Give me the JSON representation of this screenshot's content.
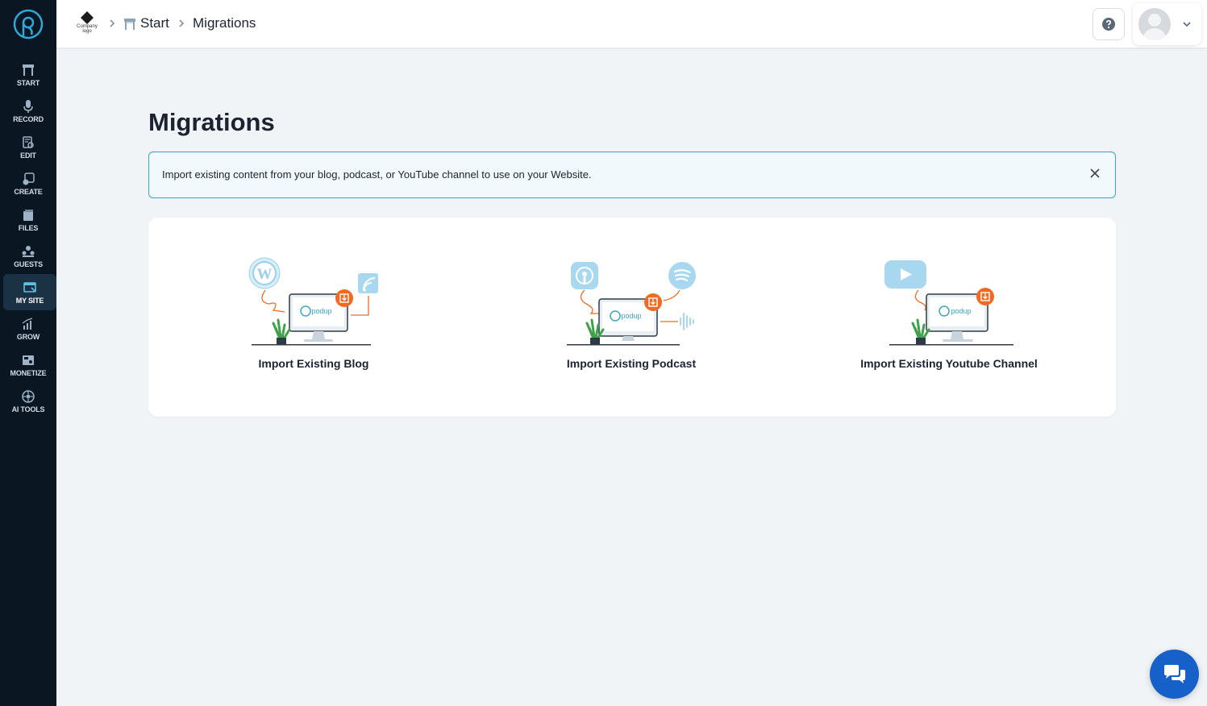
{
  "sidebar": {
    "items": [
      {
        "label": "START",
        "icon": "start-icon"
      },
      {
        "label": "RECORD",
        "icon": "microphone-icon"
      },
      {
        "label": "EDIT",
        "icon": "edit-icon"
      },
      {
        "label": "CREATE",
        "icon": "create-icon"
      },
      {
        "label": "FILES",
        "icon": "files-icon"
      },
      {
        "label": "GUESTS",
        "icon": "guests-icon"
      },
      {
        "label": "MY SITE",
        "icon": "my-site-icon",
        "active": true
      },
      {
        "label": "GROW",
        "icon": "grow-icon"
      },
      {
        "label": "MONETIZE",
        "icon": "monetize-icon"
      },
      {
        "label": "AI TOOLS",
        "icon": "ai-tools-icon"
      }
    ]
  },
  "header": {
    "company_logo_line1": "Company",
    "company_logo_line2": "logo",
    "breadcrumb_start": "Start",
    "breadcrumb_current": "Migrations"
  },
  "main": {
    "title": "Migrations",
    "info_text": "Import existing content from your blog, podcast, or YouTube channel to use on your Website.",
    "options": [
      {
        "label": "Import Existing Blog",
        "icon": "wordpress-rss-illustration"
      },
      {
        "label": "Import Existing Podcast",
        "icon": "podcast-spotify-illustration"
      },
      {
        "label": "Import Existing Youtube Channel",
        "icon": "youtube-illustration"
      }
    ],
    "illustration_screen_text": "podup"
  },
  "colors": {
    "sidebar_bg": "#0a1723",
    "accent_teal": "#3aa6c4",
    "accent_orange": "#f26a21",
    "chat_blue": "#1560c9"
  }
}
